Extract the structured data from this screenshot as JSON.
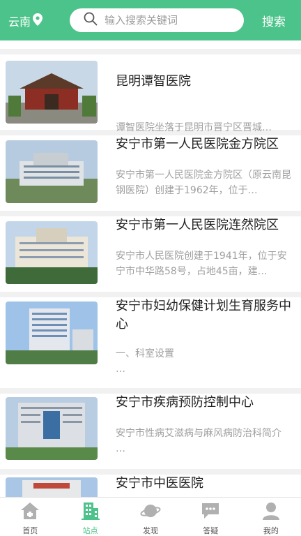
{
  "header": {
    "region": "云南",
    "search_placeholder": "输入搜索关键词",
    "search_button": "搜索"
  },
  "hospitals": [
    {
      "title": "昆明谭智医院",
      "desc": "谭智医院坐落于昆明市晋宁区晋城…"
    },
    {
      "title": "安宁市第一人民医院金方院区",
      "desc": "安宁市第一人民医院金方院区（原云南昆钢医院）创建于1962年，位于…"
    },
    {
      "title": "安宁市第一人民医院连然院区",
      "desc": "安宁市人民医院创建于1941年，位于安宁市中华路58号，占地45亩，建…"
    },
    {
      "title": "安宁市妇幼保健计划生育服务中心",
      "desc": "一、科室设置\n…"
    },
    {
      "title": "安宁市疾病预防控制中心",
      "desc": "安宁市性病艾滋病与麻风病防治科简介 …"
    },
    {
      "title": "安宁市中医医院",
      "desc": ""
    }
  ],
  "tabs": [
    {
      "label": "首页",
      "icon": "home-icon"
    },
    {
      "label": "站点",
      "icon": "building-icon",
      "active": true
    },
    {
      "label": "发现",
      "icon": "planet-icon"
    },
    {
      "label": "答疑",
      "icon": "chat-icon"
    },
    {
      "label": "我的",
      "icon": "user-icon"
    }
  ],
  "colors": {
    "accent": "#4cc38a",
    "text": "#222222",
    "muted": "#a0a0a0"
  }
}
